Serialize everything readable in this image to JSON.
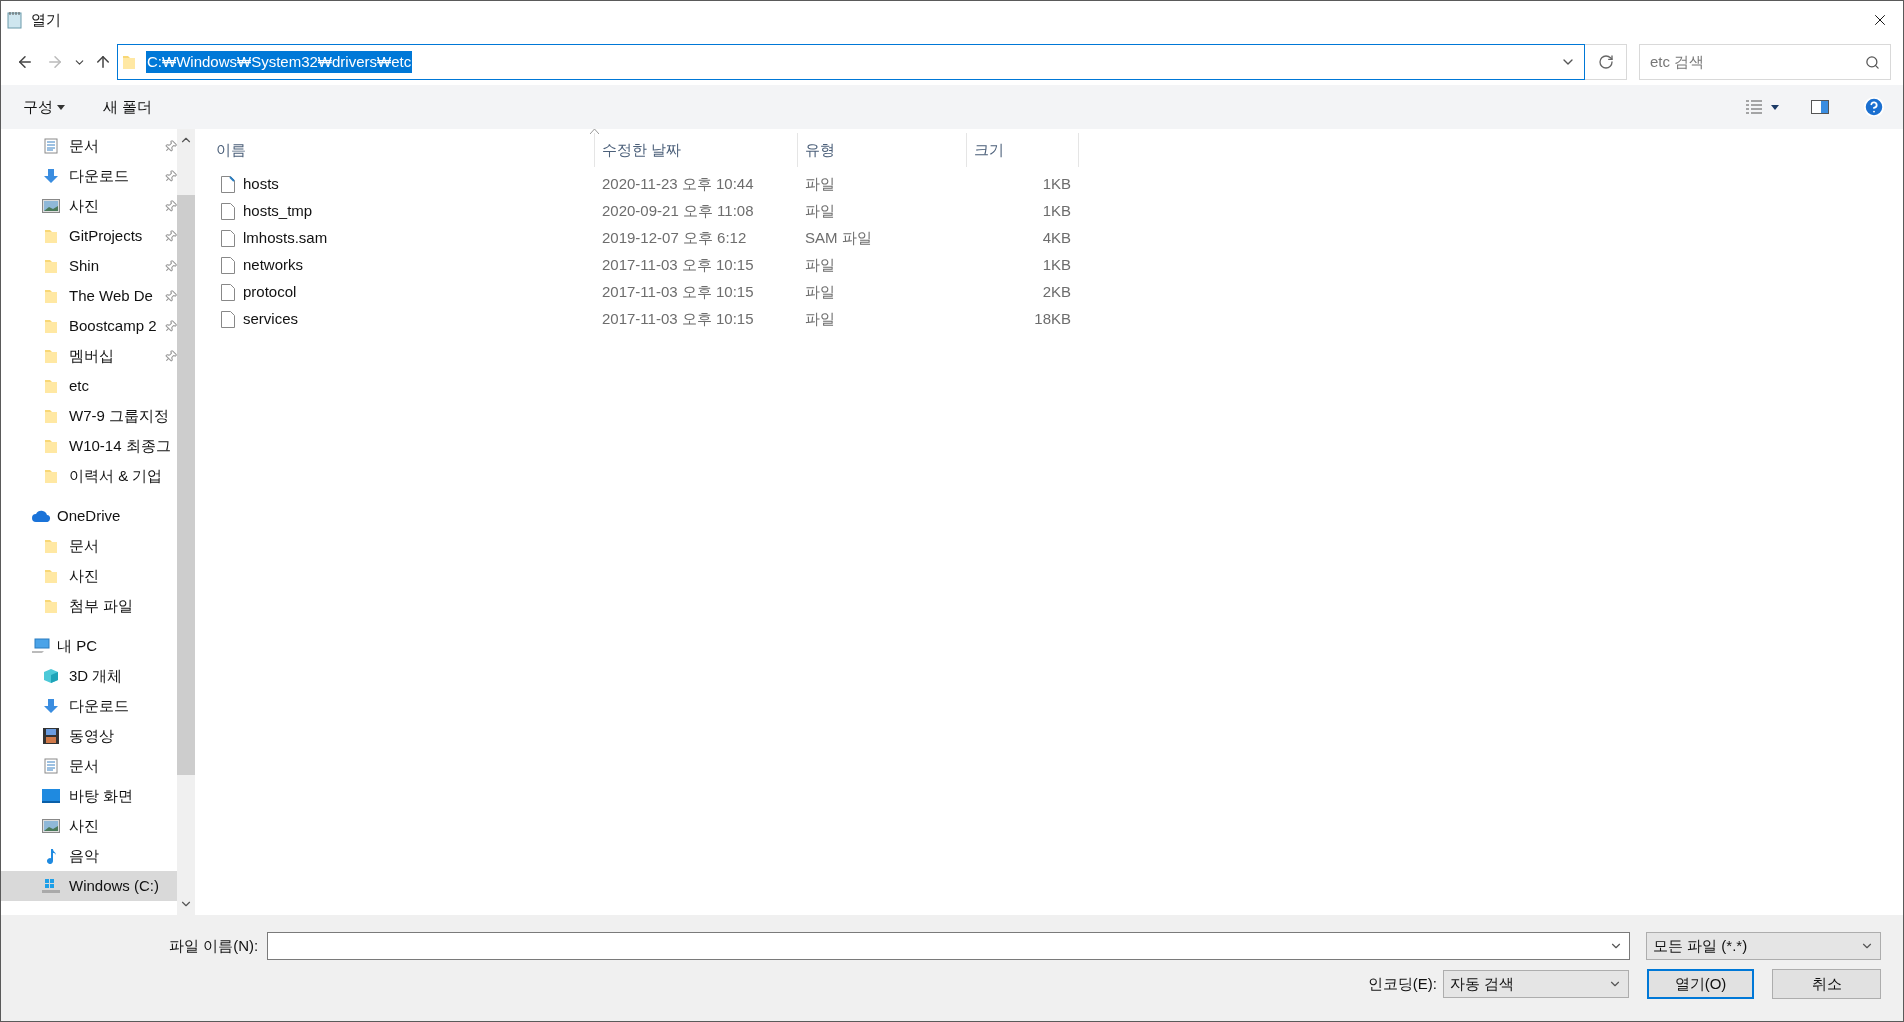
{
  "window": {
    "title": "열기"
  },
  "address": {
    "path": "C:₩Windows₩System32₩drivers₩etc",
    "selected": true
  },
  "search": {
    "placeholder": "etc 검색"
  },
  "toolbar": {
    "organize": "구성",
    "new_folder": "새 폴더"
  },
  "sidebar": {
    "items": [
      {
        "label": "문서",
        "kind": "documents",
        "pinned": true
      },
      {
        "label": "다운로드",
        "kind": "download",
        "pinned": true
      },
      {
        "label": "사진",
        "kind": "pictures",
        "pinned": true
      },
      {
        "label": "GitProjects",
        "kind": "folder",
        "pinned": true
      },
      {
        "label": "Shin",
        "kind": "folder",
        "pinned": true
      },
      {
        "label": "The Web De",
        "kind": "folder",
        "pinned": true
      },
      {
        "label": "Boostcamp 2",
        "kind": "folder",
        "pinned": true
      },
      {
        "label": "멤버십",
        "kind": "folder",
        "pinned": true
      },
      {
        "label": "etc",
        "kind": "folder",
        "pinned": false
      },
      {
        "label": "W7-9 그룹지정",
        "kind": "folder",
        "pinned": false
      },
      {
        "label": "W10-14 최종그",
        "kind": "folder",
        "pinned": false
      },
      {
        "label": "이력서 & 기업",
        "kind": "folder",
        "pinned": false
      },
      {
        "label": "OneDrive",
        "kind": "onedrive",
        "children": [
          {
            "label": "문서",
            "kind": "folder",
            "pinned": false
          },
          {
            "label": "사진",
            "kind": "folder",
            "pinned": false
          },
          {
            "label": "첨부 파일",
            "kind": "folder",
            "pinned": false
          }
        ]
      },
      {
        "label": "내 PC",
        "kind": "pc",
        "children": [
          {
            "label": "3D 개체",
            "kind": "cube",
            "pinned": false,
            "selected": false
          },
          {
            "label": "다운로드",
            "kind": "download",
            "pinned": false,
            "selected": false
          },
          {
            "label": "동영상",
            "kind": "video",
            "pinned": false,
            "selected": false
          },
          {
            "label": "문서",
            "kind": "documents",
            "pinned": false,
            "selected": false
          },
          {
            "label": "바탕 화면",
            "kind": "desktop",
            "pinned": false,
            "selected": false
          },
          {
            "label": "사진",
            "kind": "pictures",
            "pinned": false,
            "selected": false
          },
          {
            "label": "음악",
            "kind": "music",
            "pinned": false,
            "selected": false
          },
          {
            "label": "Windows (C:)",
            "kind": "drive",
            "pinned": false,
            "selected": true
          }
        ]
      }
    ]
  },
  "table": {
    "columns": [
      "이름",
      "수정한 날짜",
      "유형",
      "크기"
    ],
    "rows": [
      {
        "name": "hosts",
        "date": "2020-11-23 오후 10:44",
        "type": "파일",
        "size": "1KB",
        "kind": "shortcut"
      },
      {
        "name": "hosts_tmp",
        "date": "2020-09-21 오후 11:08",
        "type": "파일",
        "size": "1KB",
        "kind": "file"
      },
      {
        "name": "lmhosts.sam",
        "date": "2019-12-07 오후 6:12",
        "type": "SAM 파일",
        "size": "4KB",
        "kind": "file"
      },
      {
        "name": "networks",
        "date": "2017-11-03 오후 10:15",
        "type": "파일",
        "size": "1KB",
        "kind": "file"
      },
      {
        "name": "protocol",
        "date": "2017-11-03 오후 10:15",
        "type": "파일",
        "size": "2KB",
        "kind": "file"
      },
      {
        "name": "services",
        "date": "2017-11-03 오후 10:15",
        "type": "파일",
        "size": "18KB",
        "kind": "file"
      }
    ]
  },
  "footer": {
    "filename_label": "파일 이름(N):",
    "filter": "모든 파일 (*.*)",
    "encoding_label": "인코딩(E):",
    "encoding": "자동 검색",
    "open_button": "열기(O)",
    "cancel_button": "취소"
  }
}
